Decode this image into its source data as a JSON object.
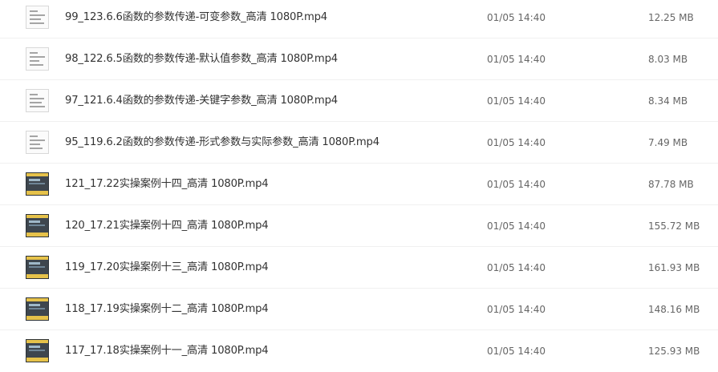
{
  "files": [
    {
      "name": "99_123.6.6函数的参数传递-可变参数_高清 1080P.mp4",
      "date": "01/05 14:40",
      "size": "12.25 MB",
      "thumbnail": "document-thumbnail"
    },
    {
      "name": "98_122.6.5函数的参数传递-默认值参数_高清 1080P.mp4",
      "date": "01/05 14:40",
      "size": "8.03 MB",
      "thumbnail": "document-thumbnail"
    },
    {
      "name": "97_121.6.4函数的参数传递-关键字参数_高清 1080P.mp4",
      "date": "01/05 14:40",
      "size": "8.34 MB",
      "thumbnail": "document-thumbnail"
    },
    {
      "name": "95_119.6.2函数的参数传递-形式参数与实际参数_高清 1080P.mp4",
      "date": "01/05 14:40",
      "size": "7.49 MB",
      "thumbnail": "document-thumbnail"
    },
    {
      "name": "121_17.22实操案例十四_高清 1080P.mp4",
      "date": "01/05 14:40",
      "size": "87.78 MB",
      "thumbnail": "screen-thumbnail"
    },
    {
      "name": "120_17.21实操案例十四_高清 1080P.mp4",
      "date": "01/05 14:40",
      "size": "155.72 MB",
      "thumbnail": "screen-thumbnail"
    },
    {
      "name": "119_17.20实操案例十三_高清 1080P.mp4",
      "date": "01/05 14:40",
      "size": "161.93 MB",
      "thumbnail": "screen-thumbnail"
    },
    {
      "name": "118_17.19实操案例十二_高清 1080P.mp4",
      "date": "01/05 14:40",
      "size": "148.16 MB",
      "thumbnail": "screen-thumbnail"
    },
    {
      "name": "117_17.18实操案例十一_高清 1080P.mp4",
      "date": "01/05 14:40",
      "size": "125.93 MB",
      "thumbnail": "screen-thumbnail"
    }
  ]
}
